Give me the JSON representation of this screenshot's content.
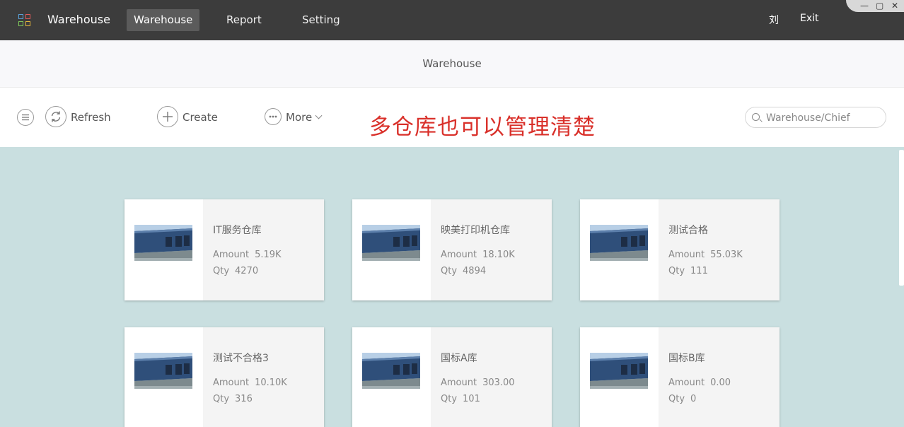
{
  "topbar": {
    "app_name": "Warehouse",
    "nav": [
      "Warehouse",
      "Report",
      "Setting"
    ],
    "user": "刘",
    "exit": "Exit",
    "window_controls": [
      "—",
      "▢",
      "✕"
    ]
  },
  "title": "Warehouse",
  "toolbar": {
    "refresh": "Refresh",
    "create": "Create",
    "more": "More",
    "promo": "多仓库也可以管理清楚",
    "search_placeholder": "Warehouse/Chief"
  },
  "labels": {
    "amount": "Amount",
    "qty": "Qty"
  },
  "cards": [
    {
      "name": "IT服务仓库",
      "amount": "5.19K",
      "qty": "4270"
    },
    {
      "name": "映美打印机仓库",
      "amount": "18.10K",
      "qty": "4894"
    },
    {
      "name": "测试合格",
      "amount": "55.03K",
      "qty": "111"
    },
    {
      "name": "测试不合格3",
      "amount": "10.10K",
      "qty": "316"
    },
    {
      "name": "国标A库",
      "amount": "303.00",
      "qty": "101"
    },
    {
      "name": "国标B库",
      "amount": "0.00",
      "qty": "0"
    }
  ],
  "colors": {
    "topbar": "#3c3c3c",
    "content_bg": "#c9dfe0",
    "promo": "#d9302a",
    "card_bg": "#f4f4f4"
  }
}
